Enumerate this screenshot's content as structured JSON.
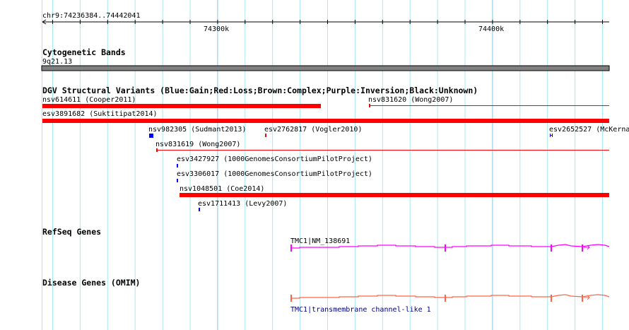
{
  "ruler": {
    "range_label": "chr9:74236384..74442041",
    "ticks": [
      "74300k",
      "74400k"
    ]
  },
  "colors": {
    "gain": "#0000ff",
    "loss": "#ff0000",
    "band": "#808080",
    "refseq": "#ff00ff",
    "omim": "#ff6347",
    "grid_minor": "#a8e8f0",
    "grid_major": "#80c8e8"
  },
  "tracks": {
    "cytoband": {
      "title": "Cytogenetic Bands",
      "band_label": "9q21.13"
    },
    "dgv": {
      "title": "DGV Structural Variants (Blue:Gain;Red:Loss;Brown:Complex;Purple:Inversion;Black:Unknown)",
      "features": [
        {
          "id": "nsv614611",
          "study": "Cooper2011",
          "label": "nsv614611 (Cooper2011)",
          "type": "Loss"
        },
        {
          "id": "nsv831620",
          "study": "Wong2007",
          "label": "nsv831620 (Wong2007)",
          "type": "Loss"
        },
        {
          "id": "esv3891682",
          "study": "Suktitipat2014",
          "label": "esv3891682 (Suktitipat2014)",
          "type": "Loss"
        },
        {
          "id": "nsv982305",
          "study": "Sudmant2013",
          "label": "nsv982305 (Sudmant2013)",
          "type": "Gain"
        },
        {
          "id": "esv2762817",
          "study": "Vogler2010",
          "label": "esv2762817 (Vogler2010)",
          "type": "Loss"
        },
        {
          "id": "esv2652527",
          "study": "McKerna",
          "label": "esv2652527 (McKerna",
          "type": "Gain"
        },
        {
          "id": "nsv831619",
          "study": "Wong2007",
          "label": "nsv831619 (Wong2007)",
          "type": "Loss"
        },
        {
          "id": "esv3427927",
          "study": "1000GenomesConsortiumPilotProject",
          "label": "esv3427927 (1000GenomesConsortiumPilotProject)",
          "type": "Gain"
        },
        {
          "id": "esv3306017",
          "study": "1000GenomesConsortiumPilotProject",
          "label": "esv3306017 (1000GenomesConsortiumPilotProject)",
          "type": "Gain"
        },
        {
          "id": "nsv1048501",
          "study": "Coe2014",
          "label": "nsv1048501 (Coe2014)",
          "type": "Loss"
        },
        {
          "id": "esv1711413",
          "study": "Levy2007",
          "label": "esv1711413 (Levy2007)",
          "type": "Gain"
        }
      ]
    },
    "refseq": {
      "title": "RefSeq Genes",
      "gene_label": "TMC1|NM_138691"
    },
    "omim": {
      "title": "Disease Genes (OMIM)",
      "gene_label": "TMC1|transmembrane channel-like 1"
    }
  }
}
